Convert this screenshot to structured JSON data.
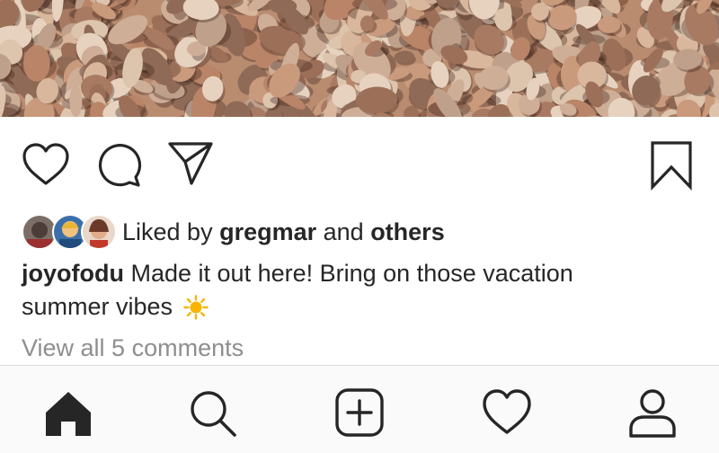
{
  "post": {
    "image_alt": "Beach covered in rounded pebbles",
    "actions": {
      "like_icon": "heart-outline-icon",
      "comment_icon": "comment-bubble-icon",
      "share_icon": "paper-plane-icon",
      "save_icon": "bookmark-icon"
    },
    "likes": {
      "prefix": "Liked by ",
      "user": "gregmar",
      "joiner": " and ",
      "others": "others"
    },
    "caption": {
      "username": "joyofodu",
      "text": "Made it out here! Bring on those vacation summer vibes",
      "emoji": "sun"
    },
    "comments_link": "View all 5 comments"
  },
  "bottom_nav": {
    "items": [
      "home-icon",
      "search-icon",
      "new-post-icon",
      "activity-heart-icon",
      "profile-icon"
    ]
  },
  "colors": {
    "text": "#262626",
    "muted": "#8e8e8e",
    "nav_background": "#fafafa",
    "border": "#dbdbdb",
    "sun": "#f7b500"
  }
}
